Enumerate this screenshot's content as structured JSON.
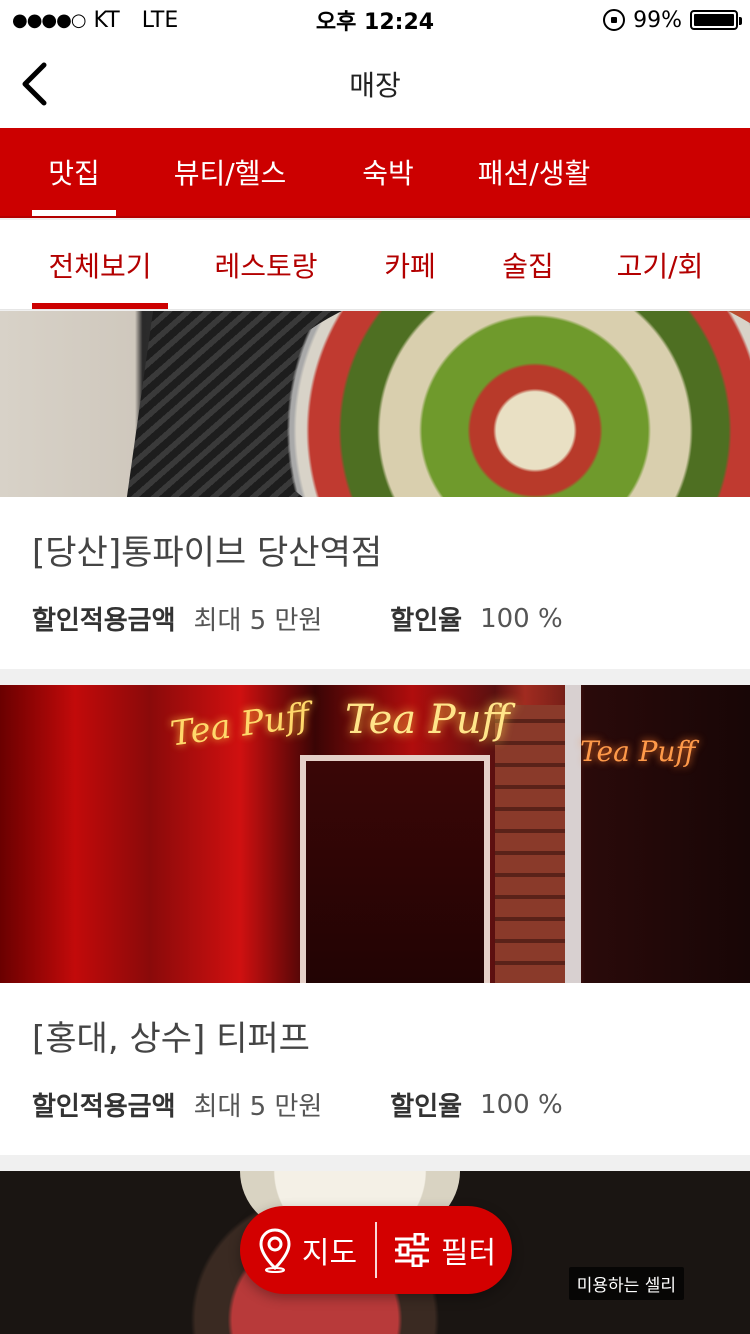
{
  "status_bar": {
    "carrier": "KT",
    "signal": "●●●●○",
    "network": "LTE",
    "time": "오후 12:24",
    "battery_percent": "99%",
    "battery_level": 0.99
  },
  "header": {
    "title": "매장"
  },
  "primary_tabs": [
    {
      "label": "맛집",
      "active": true
    },
    {
      "label": "뷰티/헬스",
      "active": false
    },
    {
      "label": "숙박",
      "active": false
    },
    {
      "label": "패션/생활",
      "active": false
    }
  ],
  "secondary_tabs": [
    {
      "label": "전체보기",
      "active": true
    },
    {
      "label": "레스토랑",
      "active": false
    },
    {
      "label": "카페",
      "active": false
    },
    {
      "label": "술집",
      "active": false
    },
    {
      "label": "고기/회",
      "active": false
    }
  ],
  "stores": [
    {
      "name": "[당산]통파이브 당산역점",
      "discount_amount_label": "할인적용금액",
      "discount_amount_value": "최대 5 만원",
      "discount_rate_label": "할인율",
      "discount_rate_value": "100 %"
    },
    {
      "name": "[홍대, 상수] 티퍼프",
      "discount_amount_label": "할인적용금액",
      "discount_amount_value": "최대 5 만원",
      "discount_rate_label": "할인율",
      "discount_rate_value": "100 %",
      "sign_text": "Tea Puff"
    },
    {
      "name": "",
      "watermark": "미용하는 셀리"
    }
  ],
  "fab": {
    "map_label": "지도",
    "filter_label": "필터"
  },
  "colors": {
    "brand_red": "#cc0000",
    "tab_text_red": "#b30000"
  },
  "icons": {
    "back": "chevron-left-icon",
    "map": "map-pin-icon",
    "filter": "sliders-icon"
  }
}
